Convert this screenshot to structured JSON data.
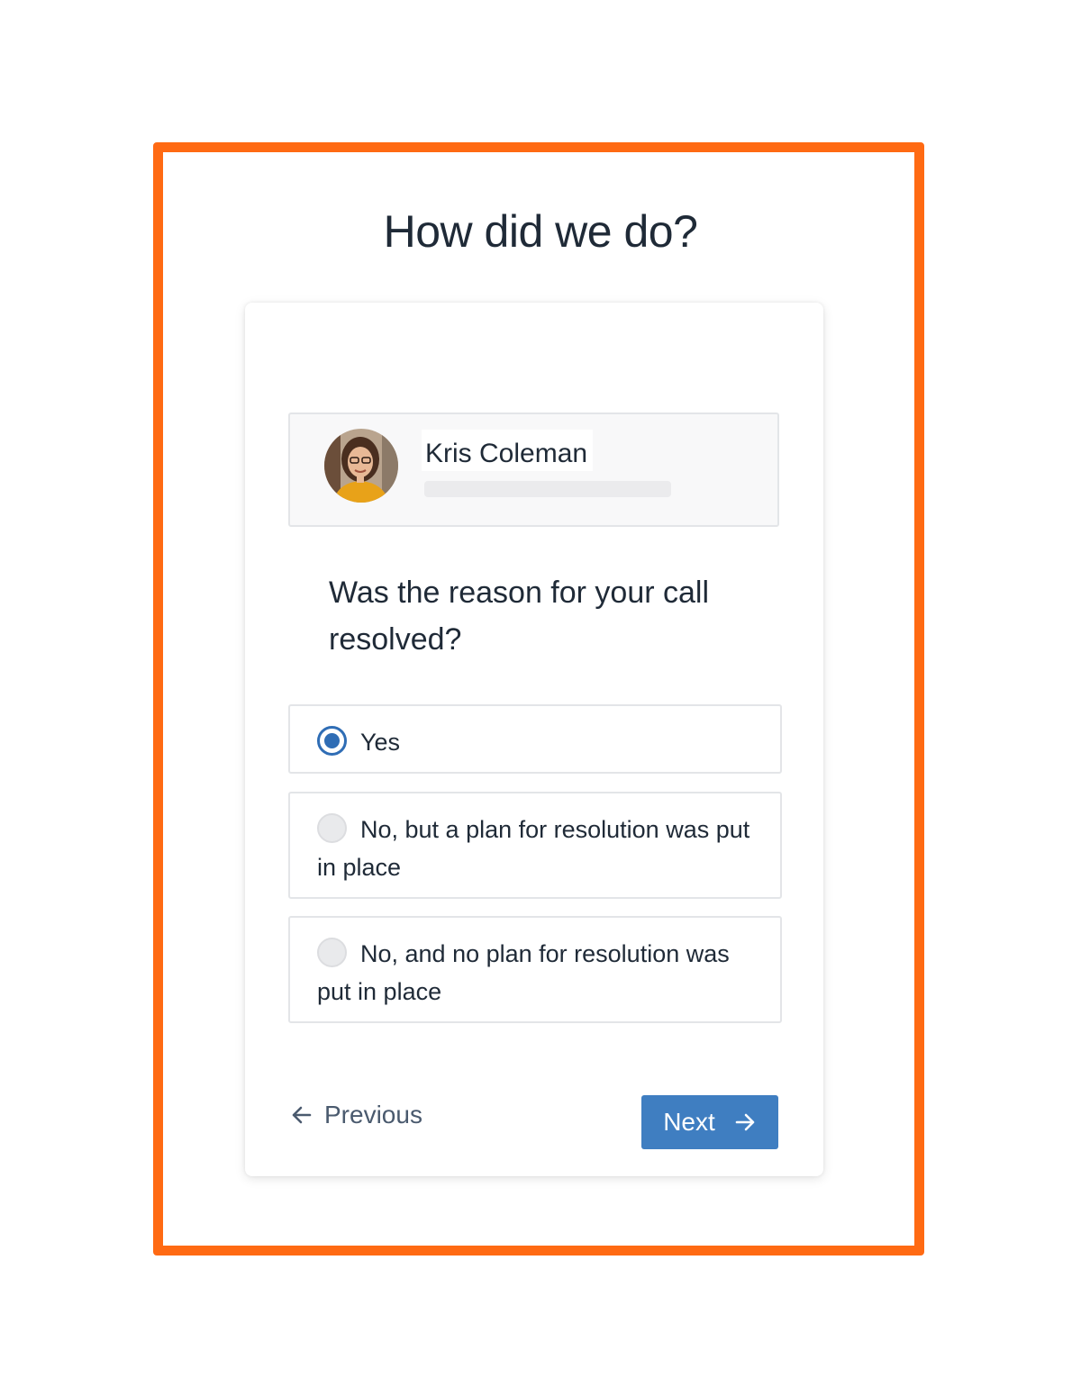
{
  "survey": {
    "title": "How did we do?",
    "agent": {
      "name": "Kris Coleman"
    },
    "question": "Was the reason for your call resolved?",
    "options": [
      {
        "label": "Yes",
        "selected": true
      },
      {
        "label": "No, but a plan for resolution was put in place",
        "selected": false
      },
      {
        "label": "No, and no plan for resolution was put in place",
        "selected": false
      }
    ],
    "nav": {
      "previous_label": "Previous",
      "next_label": "Next"
    }
  },
  "colors": {
    "frame_outline": "#ff6a13",
    "primary_button": "#3f7ec1",
    "radio_selected": "#2f6db5",
    "text": "#1f2a37"
  },
  "icons": {
    "previous": "arrow-left-icon",
    "next": "arrow-right-icon",
    "option_selected": "radio-checked-icon",
    "option_unselected": "radio-unchecked-icon"
  }
}
